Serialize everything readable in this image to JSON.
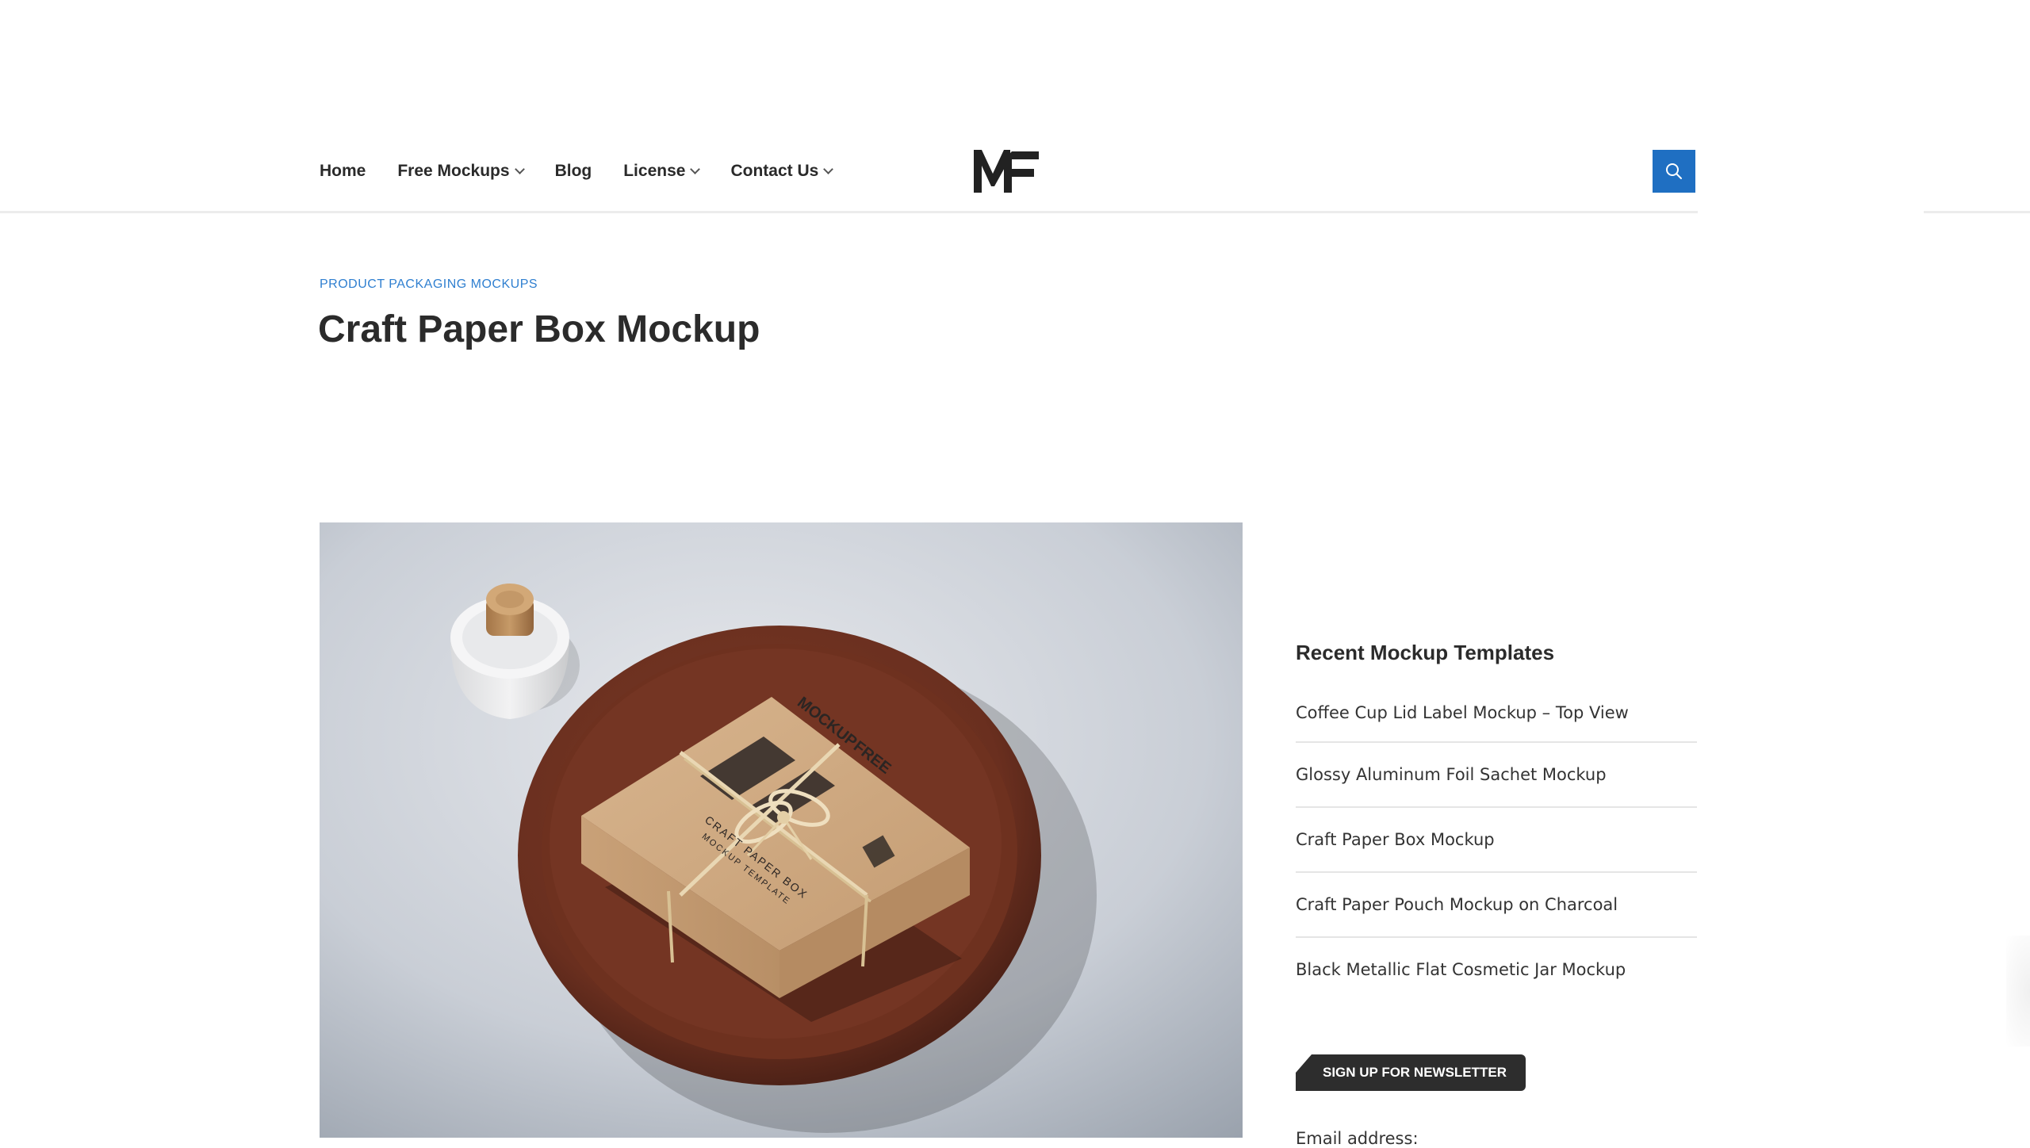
{
  "nav": {
    "items": [
      {
        "label": "Home",
        "dropdown": false
      },
      {
        "label": "Free Mockups",
        "dropdown": true
      },
      {
        "label": "Blog",
        "dropdown": false
      },
      {
        "label": "License",
        "dropdown": true
      },
      {
        "label": "Contact Us",
        "dropdown": true
      }
    ]
  },
  "logo": {
    "text": "MF"
  },
  "search": {
    "icon": "search-icon",
    "color": "#1f6fc2"
  },
  "post": {
    "category": "PRODUCT PACKAGING MOCKUPS",
    "title": "Craft Paper Box Mockup"
  },
  "featured_image": {
    "printed_text": [
      "MOCKUP",
      "FREE",
      "CRAFT PAPER BOX",
      "MOCKUP TEMPLATE"
    ]
  },
  "sidebar": {
    "recent_title": "Recent Mockup Templates",
    "recent": [
      "Coffee Cup Lid Label Mockup – Top View",
      "Glossy Aluminum Foil Sachet Mockup",
      "Craft Paper Box Mockup",
      "Craft Paper Pouch Mockup on Charcoal",
      "Black Metallic Flat Cosmetic Jar Mockup"
    ],
    "newsletter_label": "SIGN UP FOR NEWSLETTER",
    "email_label": "Email address:"
  },
  "colors": {
    "accent": "#1f6fc2",
    "category": "#2f7fd0",
    "badge": "#2d2d2d"
  }
}
